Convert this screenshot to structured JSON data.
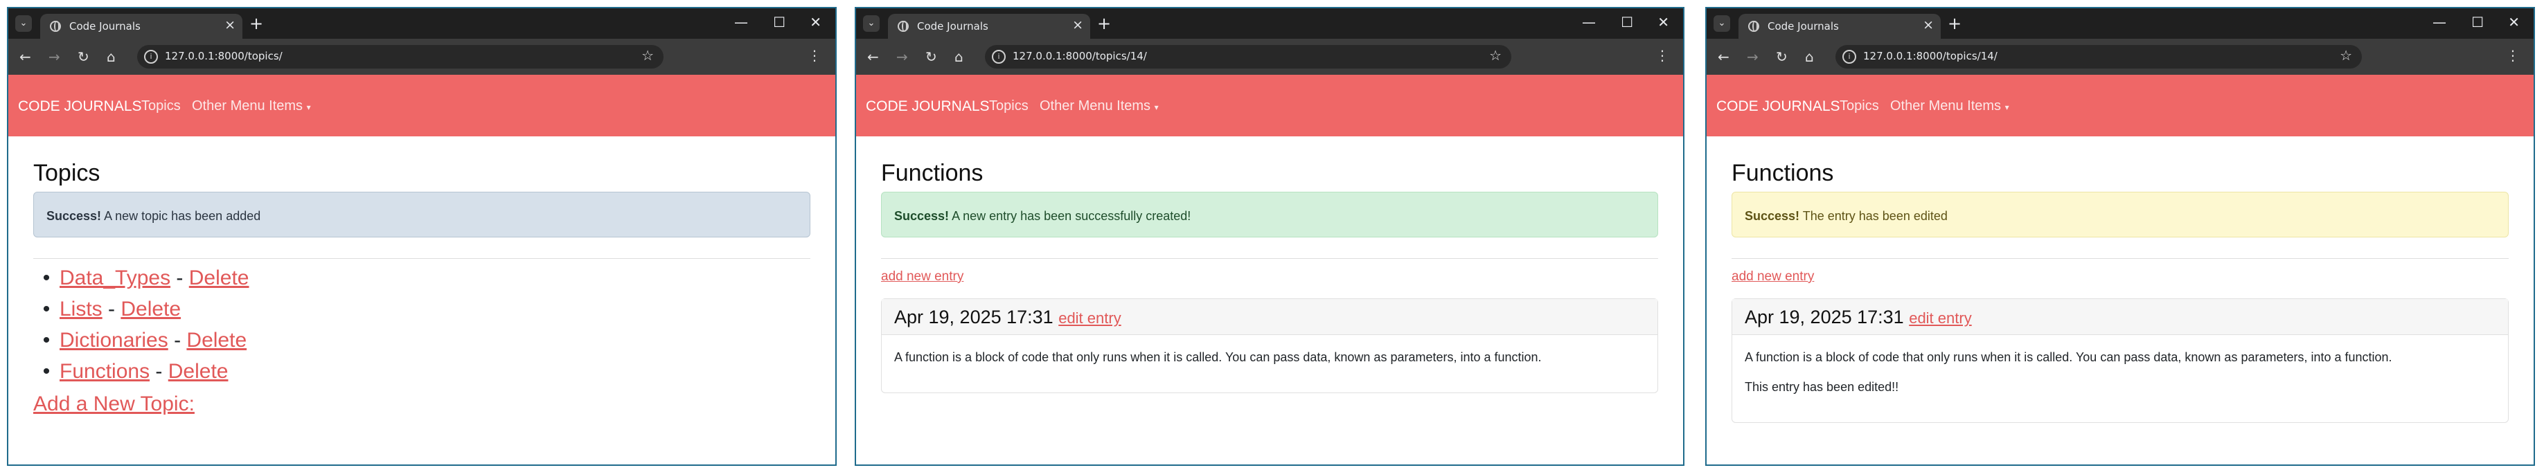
{
  "windows": [
    {
      "tab_title": "Code Journals",
      "url": "127.0.0.1:8000/topics/",
      "brand": "CODE JOURNALS",
      "nav_topics": "Topics",
      "nav_other": "Other Menu Items",
      "page_title": "Topics",
      "alert": {
        "strong": "Success!",
        "text": " A new topic has been added",
        "color": "#d6e0ea"
      },
      "topics": [
        {
          "name": "Data_Types",
          "sep": " - ",
          "delete": "Delete"
        },
        {
          "name": "Lists",
          "sep": " - ",
          "delete": "Delete"
        },
        {
          "name": "Dictionaries",
          "sep": " - ",
          "delete": "Delete"
        },
        {
          "name": "Functions",
          "sep": " - ",
          "delete": "Delete"
        }
      ],
      "add_topic": "Add a New Topic:"
    },
    {
      "tab_title": "Code Journals",
      "url": "127.0.0.1:8000/topics/14/",
      "brand": "CODE JOURNALS",
      "nav_topics": "Topics",
      "nav_other": "Other Menu Items",
      "page_title": "Functions",
      "alert": {
        "strong": "Success!",
        "text": " A new entry has been successfully created!",
        "color": "#d3f0db"
      },
      "add_entry": "add new entry",
      "entry": {
        "date": "Apr 19, 2025 17:31",
        "edit": "edit entry",
        "text": "A function is a block of code that only runs when it is called. You can pass data, known as parameters, into a function."
      }
    },
    {
      "tab_title": "Code Journals",
      "url": "127.0.0.1:8000/topics/14/",
      "brand": "CODE JOURNALS",
      "nav_topics": "Topics",
      "nav_other": "Other Menu Items",
      "page_title": "Functions",
      "alert": {
        "strong": "Success!",
        "text": " The entry has been edited",
        "color": "#fdf8d0"
      },
      "add_entry": "add new entry",
      "entry": {
        "date": "Apr 19, 2025 17:31",
        "edit": "edit entry",
        "text": "A function is a block of code that only runs when it is called. You can pass data, known as parameters, into a function.",
        "text2": "This entry has been edited!!"
      }
    }
  ],
  "colors": {
    "navbar": "#ef6767",
    "link": "#e15858",
    "chrome_dark": "#1f1f1f"
  },
  "icons": [
    "tab-search-icon",
    "globe-favicon-icon",
    "close-tab-icon",
    "new-tab-icon",
    "minimize-icon",
    "maximize-icon",
    "close-window-icon",
    "back-icon",
    "forward-icon",
    "reload-icon",
    "home-icon",
    "site-info-icon",
    "bookmark-star-icon",
    "browser-menu-icon",
    "dropdown-caret-icon"
  ]
}
